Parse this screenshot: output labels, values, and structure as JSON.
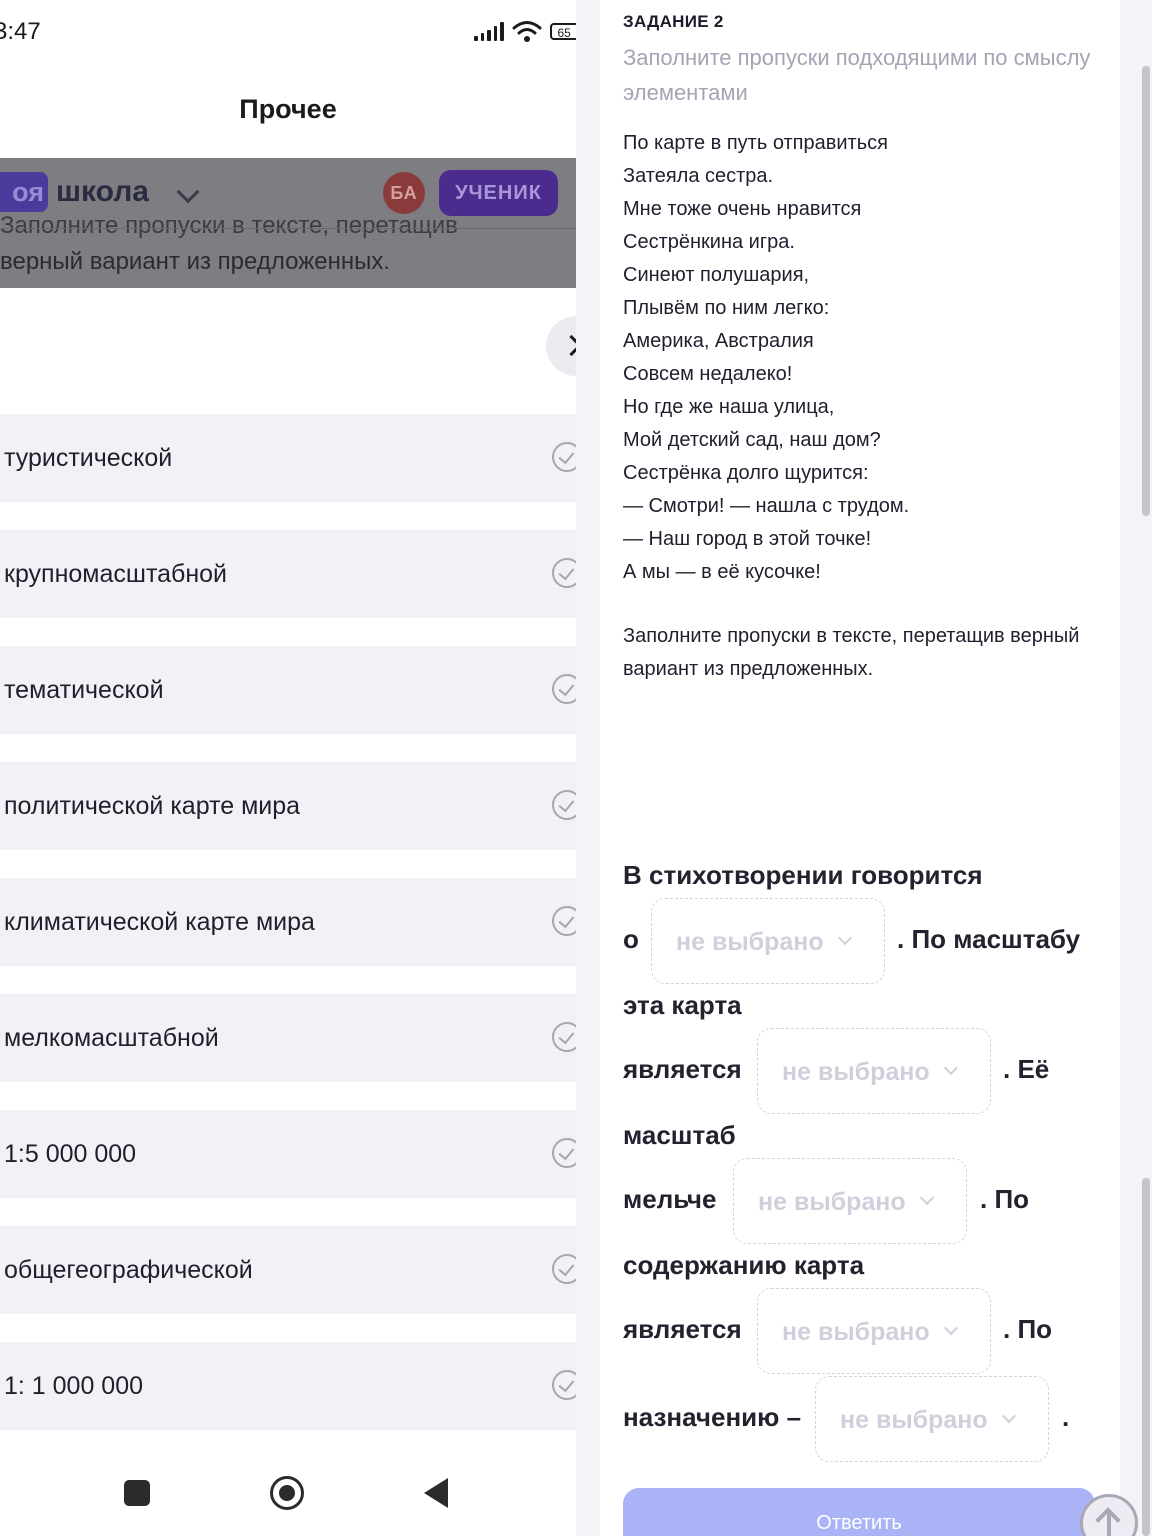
{
  "status_bar": {
    "time": "3:47",
    "battery": "65"
  },
  "left": {
    "page_title": "Прочее",
    "app": {
      "logo_badge": "оя",
      "logo_word": "школа",
      "avatar": "БА",
      "role": "УЧЕНИК"
    },
    "task_overlay_line1": "Заполните пропуски в тексте, перетащив",
    "task_overlay_line2": "верный вариант из предложенных.",
    "options": [
      "туристической",
      "крупномасштабной",
      "тематической",
      "политической карте мира",
      "климатической карте мира",
      "мелкомасштабной",
      "1:5 000 000",
      "общегеографической",
      "1: 1 000 000"
    ]
  },
  "right": {
    "task_heading": "ЗАДАНИЕ 2",
    "task_description": "Заполните пропуски подходящими по смыслу элементами",
    "poem": [
      "По карте в путь отправиться",
      "Затеяла сестра.",
      "Мне тоже очень нравится",
      "Сестрёнкина игра.",
      "Синеют полушария,",
      "Плывём по ним легко:",
      "Америка, Австралия",
      "Совсем недалеко!",
      "Но где же наша улица,",
      "Мой детский сад, наш дом?",
      "Сестрёнка долго щурится:",
      "— Смотри! — нашла с трудом.",
      "— Наш город в этой точке!",
      "А мы — в её кусочке!"
    ],
    "instruction": "Заполните пропуски в тексте, перетащив верный вариант из предложенных.",
    "question": {
      "s1": "В стихотворении говорится",
      "s2": "о",
      "s3": ". По масштабу",
      "s4": "эта карта",
      "s5": "является",
      "s6": ". Её",
      "s7": "масштаб",
      "s8": "мельче",
      "s9": ". По",
      "s10": "содержанию карта",
      "s11": "является",
      "s12": ". По",
      "s13": "назначению –",
      "s14": "."
    },
    "dropdown_placeholder": "не выбрано",
    "submit_label": "Ответить"
  }
}
